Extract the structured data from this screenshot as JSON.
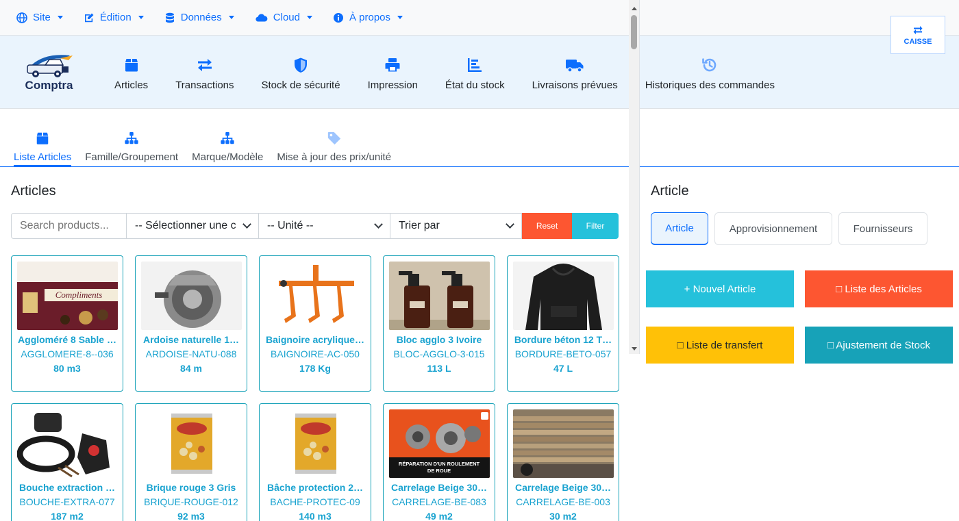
{
  "topmenu": [
    {
      "label": "Site",
      "icon": "globe-icon"
    },
    {
      "label": "Édition",
      "icon": "edit-icon"
    },
    {
      "label": "Données",
      "icon": "database-icon"
    },
    {
      "label": "Cloud",
      "icon": "cloud-icon"
    },
    {
      "label": "À propos",
      "icon": "info-icon"
    }
  ],
  "caisse": {
    "label": "CAISSE",
    "icon": "exchange-icon"
  },
  "logo": {
    "text": "Comptra"
  },
  "modules": [
    {
      "label": "Articles",
      "icon": "box-icon"
    },
    {
      "label": "Transactions",
      "icon": "exchange-icon"
    },
    {
      "label": "Stock de sécurité",
      "icon": "shield-icon"
    },
    {
      "label": "Impression",
      "icon": "printer-icon"
    },
    {
      "label": "État du stock",
      "icon": "bar-chart-icon"
    },
    {
      "label": "Livraisons prévues",
      "icon": "truck-icon"
    },
    {
      "label": "Historiques des commandes",
      "icon": "history-icon"
    }
  ],
  "subtabs": [
    {
      "label": "Liste Articles",
      "icon": "box-icon",
      "active": true
    },
    {
      "label": "Famille/Groupement",
      "icon": "sitemap-icon"
    },
    {
      "label": "Marque/Modèle",
      "icon": "sitemap-icon"
    },
    {
      "label": "Mise à jour des prix/unité",
      "icon": "tag-icon"
    }
  ],
  "left": {
    "title": "Articles",
    "search": {
      "placeholder": "Search products..."
    },
    "category_select": "-- Sélectionner une c",
    "unit_select": "-- Unité --",
    "sort_select": "Trier par",
    "reset_label": "Reset",
    "filter_label": "Filter"
  },
  "products": [
    {
      "name": "Aggloméré 8 Sable …",
      "code": "AGGLOMERE-8--036",
      "qty": "80 m3",
      "img": "chocolate-box"
    },
    {
      "name": "Ardoise naturelle 1…",
      "code": "ARDOISE-NATU-088",
      "qty": "84 m",
      "img": "alternator"
    },
    {
      "name": "Baignoire acrylique…",
      "code": "BAIGNOIRE-AC-050",
      "qty": "178 Kg",
      "img": "plough"
    },
    {
      "name": "Bloc agglo 3 Ivoire",
      "code": "BLOC-AGGLO-3-015",
      "qty": "113 L",
      "img": "spray-bottles"
    },
    {
      "name": "Bordure béton 12 T…",
      "code": "BORDURE-BETO-057",
      "qty": "47 L",
      "img": "hoodie"
    },
    {
      "name": "Bouche extraction …",
      "code": "BOUCHE-EXTRA-077",
      "qty": "187 m2",
      "img": "plug-part"
    },
    {
      "name": "Brique rouge 3 Gris",
      "code": "BRIQUE-ROUGE-012",
      "qty": "92 m3",
      "img": "can"
    },
    {
      "name": "Bâche protection 2…",
      "code": "BACHE-PROTEC-09",
      "qty": "140 m3",
      "img": "can"
    },
    {
      "name": "Carrelage Beige 30…",
      "code": "CARRELAGE-BE-083",
      "qty": "49 m2",
      "img": "bearings",
      "img_caption": "RÉPARATION D'UN ROULEMENT DE ROUE"
    },
    {
      "name": "Carrelage Beige 30…",
      "code": "CARRELAGE-BE-003",
      "qty": "30 m2",
      "img": "planks"
    }
  ],
  "right": {
    "title": "Article",
    "tabs": [
      "Article",
      "Approvisionnement",
      "Fournisseurs"
    ],
    "actions": [
      {
        "label": "+ Nouvel Article",
        "color": "#25c1db"
      },
      {
        "label": "□ Liste des Articles",
        "color": "#fd5631"
      },
      {
        "label": "□ Liste de transfert",
        "color": "#ffc107"
      },
      {
        "label": "□ Ajustement de Stock",
        "color": "#17a2b8"
      }
    ]
  }
}
